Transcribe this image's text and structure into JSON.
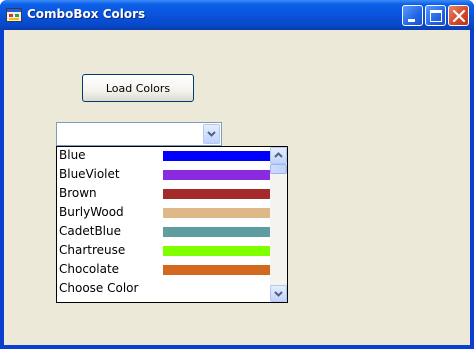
{
  "window": {
    "title": "ComboBox Colors"
  },
  "titlebar_buttons": {
    "minimize": "minimize-icon",
    "maximize": "maximize-icon",
    "close": "close-icon"
  },
  "load_button": {
    "label": "Load Colors"
  },
  "combo": {
    "value": ""
  },
  "dropdown": {
    "items": [
      {
        "label": "Blue",
        "color": "#0000FF"
      },
      {
        "label": "BlueViolet",
        "color": "#8A2BE2"
      },
      {
        "label": "Brown",
        "color": "#A52A2A"
      },
      {
        "label": "BurlyWood",
        "color": "#DEB887"
      },
      {
        "label": "CadetBlue",
        "color": "#5F9EA0"
      },
      {
        "label": "Chartreuse",
        "color": "#7FFF00"
      },
      {
        "label": "Chocolate",
        "color": "#D2691E"
      },
      {
        "label": "Choose Color",
        "color": ""
      }
    ]
  }
}
